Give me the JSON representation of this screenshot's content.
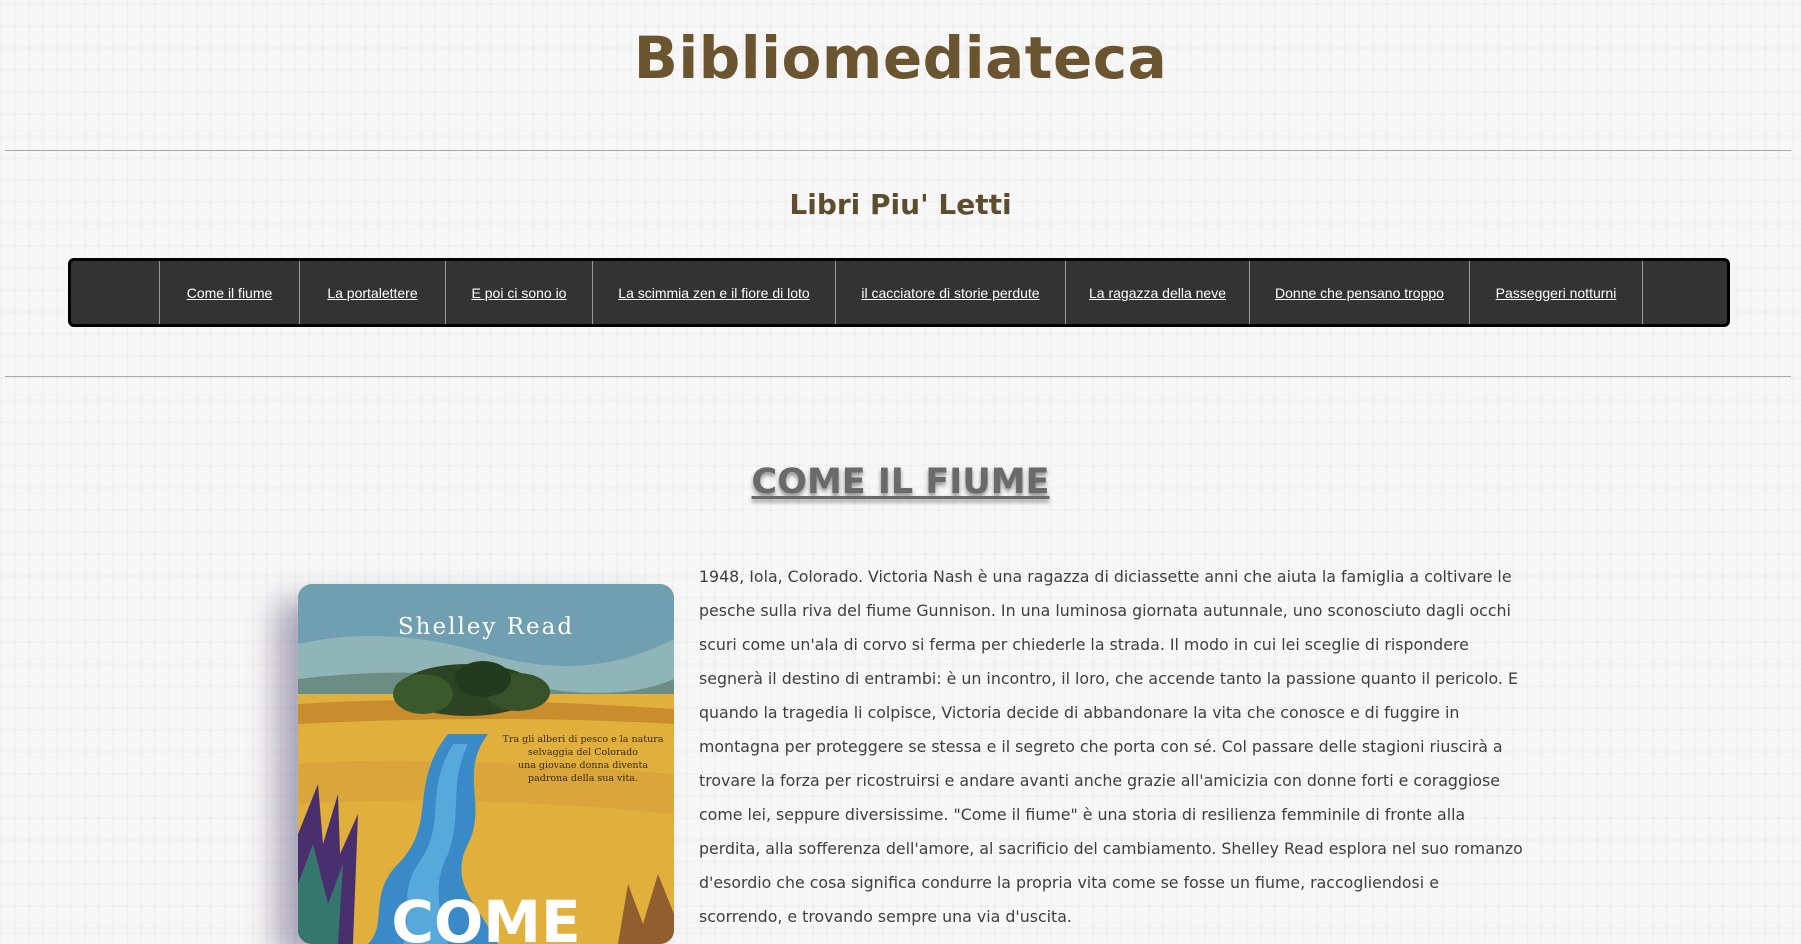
{
  "site": {
    "title": "Bibliomediateca"
  },
  "section": {
    "title": "Libri Piu' Letti"
  },
  "nav": {
    "items": [
      {
        "label": "Come il fiume"
      },
      {
        "label": "La portalettere"
      },
      {
        "label": "E poi ci sono io"
      },
      {
        "label": "La scimmia zen e il fiore di loto"
      },
      {
        "label": "il cacciatore di storie perdute"
      },
      {
        "label": "La ragazza della neve"
      },
      {
        "label": "Donne che pensano troppo"
      },
      {
        "label": "Passeggeri notturni"
      }
    ]
  },
  "book": {
    "title": "COME IL FIUME",
    "cover": {
      "author": "Shelley Read",
      "tagline_lines": [
        "Tra gli alberi di pesco e la natura",
        "selvaggia del Colorado",
        "una giovane donna diventa",
        "padrona della sua vita."
      ],
      "title_partial": "COME"
    },
    "description": "1948, Iola, Colorado. Victoria Nash è una ragazza di diciassette anni che aiuta la famiglia a coltivare le pesche sulla riva del fiume Gunnison. In una luminosa giornata autunnale, uno sconosciuto dagli occhi scuri come un'ala di corvo si ferma per chiederle la strada. Il modo in cui lei sceglie di rispondere segnerà il destino di entrambi: è un incontro, il loro, che accende tanto la passione quanto il pericolo. E quando la tragedia li colpisce, Victoria decide di abbandonare la vita che conosce e di fuggire in montagna per proteggere se stessa e il segreto che porta con sé. Col passare delle stagioni riuscirà a trovare la forza per ricostruirsi e andare avanti anche grazie all'amicizia con donne forti e coraggiose come lei, seppure diversissime. \"Come il fiume\" è una storia di resilienza femminile di fronte alla perdita, alla sofferenza dell'amore, al sacrificio del cambiamento. Shelley Read esplora nel suo romanzo d'esordio che cosa significa condurre la propria vita come se fosse un fiume, raccogliendosi e scorrendo, e trovando sempre una via d'uscita."
  },
  "colors": {
    "title": "#6b5530",
    "nav_bg": "#333333",
    "nav_text": "#ffffff",
    "body_text": "#3e3e3e"
  }
}
